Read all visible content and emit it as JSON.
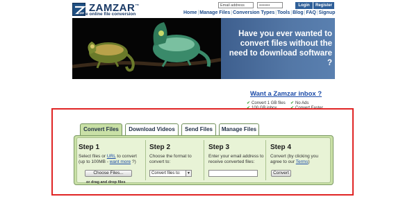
{
  "header": {
    "brand": "ZAMZAR",
    "brand_tm": "™",
    "tagline": "Free online file conversion",
    "email_placeholder": "Email address",
    "password_value": "••••••••",
    "login_label": "Login",
    "register_label": "Register",
    "nav": [
      "Home",
      "Manage Files",
      "Conversion Types",
      "Tools",
      "Blog",
      "FAQ",
      "Signup"
    ]
  },
  "banner": {
    "headline": "Have you ever wanted to convert files without the need to download software ?"
  },
  "inbox": {
    "title": "Want a Zamzar inbox ?",
    "features": [
      "Convert 1 GB files",
      "No Ads",
      "100 GB inbox",
      "Convert Faster"
    ]
  },
  "tabs": [
    {
      "label": "Convert Files",
      "active": true
    },
    {
      "label": "Download Videos",
      "active": false
    },
    {
      "label": "Send Files",
      "active": false
    },
    {
      "label": "Manage Files",
      "active": false
    }
  ],
  "steps": {
    "step1": {
      "title": "Step 1",
      "desc_a": "Select files or ",
      "desc_link": "URL",
      "desc_b": " to convert",
      "desc_c": "(up to 100MB - ",
      "desc_more": "want more",
      "desc_d": " ?)",
      "button": "Choose Files...",
      "drag": "or drag and drop files"
    },
    "step2": {
      "title": "Step 2",
      "desc": "Choose the format to convert to:",
      "select_value": "Convert files to:"
    },
    "step3": {
      "title": "Step 3",
      "desc": "Enter your email address to receive converted files:",
      "email_value": ""
    },
    "step4": {
      "title": "Step 4",
      "desc_a": "Convert (by clicking you agree to our ",
      "desc_link": "Terms",
      "desc_b": ")",
      "button": "Convert"
    }
  },
  "colors": {
    "brand_blue": "#1a3a66",
    "tab_green": "#c9e0a6",
    "highlight_red": "#e02424"
  }
}
